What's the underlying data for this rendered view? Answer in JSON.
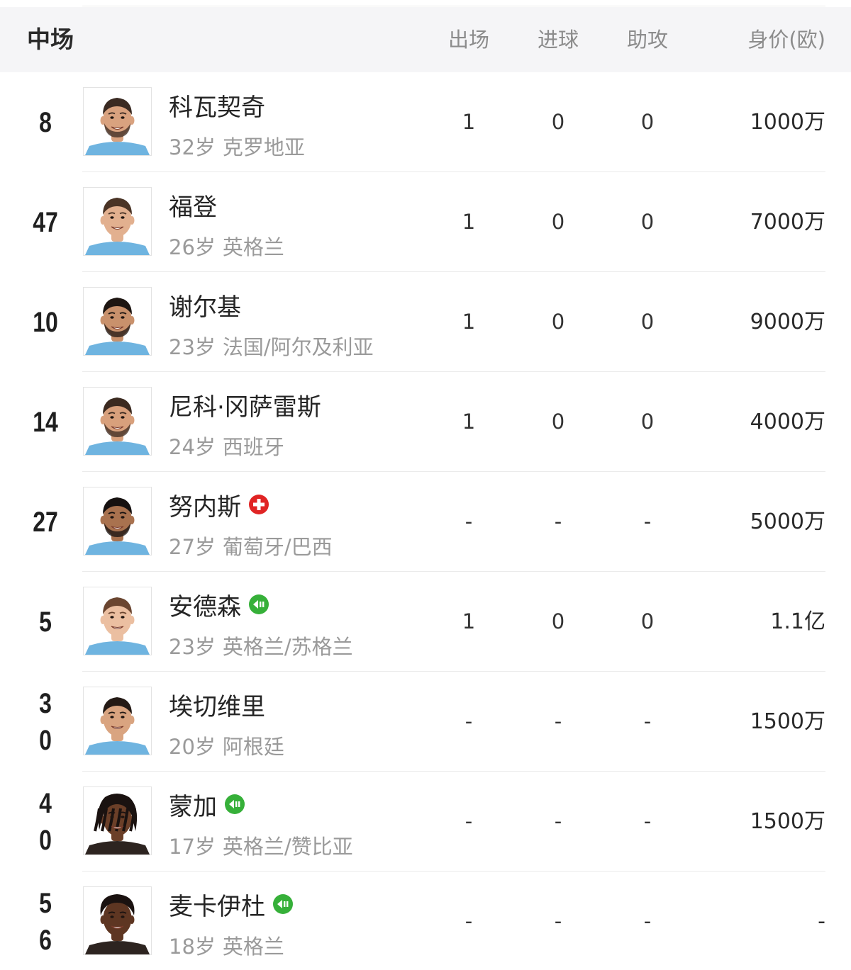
{
  "header": {
    "section_title": "中场",
    "col_apps": "出场",
    "col_goals": "进球",
    "col_assists": "助攻",
    "col_value": "身价(欧)"
  },
  "players": [
    {
      "number": [
        "8"
      ],
      "name": "科瓦契奇",
      "age": "32岁",
      "nationality": "克罗地亚",
      "apps": "1",
      "goals": "0",
      "assists": "0",
      "value": "1000万",
      "badge": null,
      "hair": "#3a2a22",
      "skin": "#d9a27f",
      "beard": true
    },
    {
      "number": [
        "47"
      ],
      "name": "福登",
      "age": "26岁",
      "nationality": "英格兰",
      "apps": "1",
      "goals": "0",
      "assists": "0",
      "value": "7000万",
      "badge": null,
      "hair": "#4a3426",
      "skin": "#e2b08f",
      "beard": false
    },
    {
      "number": [
        "10"
      ],
      "name": "谢尔基",
      "age": "23岁",
      "nationality": "法国/阿尔及利亚",
      "apps": "1",
      "goals": "0",
      "assists": "0",
      "value": "9000万",
      "badge": null,
      "hair": "#1e1612",
      "skin": "#c9916c",
      "beard": true
    },
    {
      "number": [
        "14"
      ],
      "name": "尼科·冈萨雷斯",
      "age": "24岁",
      "nationality": "西班牙",
      "apps": "1",
      "goals": "0",
      "assists": "0",
      "value": "4000万",
      "badge": null,
      "hair": "#3b2a20",
      "skin": "#d8a07c",
      "beard": true
    },
    {
      "number": [
        "27"
      ],
      "name": "努内斯",
      "age": "27岁",
      "nationality": "葡萄牙/巴西",
      "apps": "-",
      "goals": "-",
      "assists": "-",
      "value": "5000万",
      "badge": "injury-cross",
      "hair": "#161110",
      "skin": "#a9724f",
      "beard": true
    },
    {
      "number": [
        "5"
      ],
      "name": "安德森",
      "age": "23岁",
      "nationality": "英格兰/苏格兰",
      "apps": "1",
      "goals": "0",
      "assists": "0",
      "value": "1.1亿",
      "badge": "transfer-in",
      "hair": "#6a4530",
      "skin": "#ebbfa1",
      "beard": false
    },
    {
      "number": [
        "3",
        "0"
      ],
      "name": "埃切维里",
      "age": "20岁",
      "nationality": "阿根廷",
      "apps": "-",
      "goals": "-",
      "assists": "-",
      "value": "1500万",
      "badge": null,
      "hair": "#241a15",
      "skin": "#d9a480",
      "beard": false
    },
    {
      "number": [
        "4",
        "0"
      ],
      "name": "蒙加",
      "age": "17岁",
      "nationality": "英格兰/赞比亚",
      "apps": "-",
      "goals": "-",
      "assists": "-",
      "value": "1500万",
      "badge": "transfer-in",
      "hair": "#1a1210",
      "skin": "#6b3f28",
      "beard": false
    },
    {
      "number": [
        "5",
        "6"
      ],
      "name": "麦卡伊杜",
      "age": "18岁",
      "nationality": "英格兰",
      "apps": "-",
      "goals": "-",
      "assists": "-",
      "value": "-",
      "badge": "transfer-in",
      "hair": "#1a1210",
      "skin": "#5e3622",
      "beard": false
    }
  ],
  "colors": {
    "header_bg": "#f5f5f7",
    "kit_blue": "#6fb4e0",
    "badge_red": "#e02424",
    "badge_green": "#36b039"
  }
}
